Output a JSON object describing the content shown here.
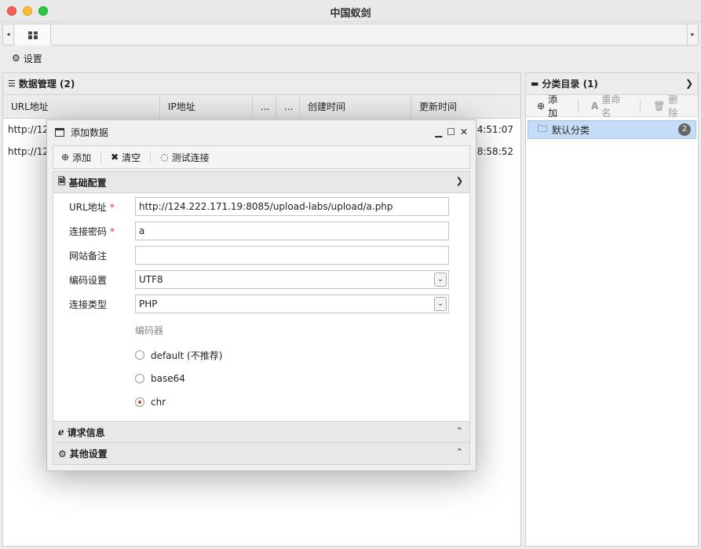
{
  "window": {
    "title": "中国蚁剑"
  },
  "tabs": {
    "left_arrow": "◂",
    "right_arrow": "▸"
  },
  "settings": {
    "label": "设置"
  },
  "data_panel": {
    "title": "数据管理 (2)",
    "columns": [
      "URL地址",
      "IP地址",
      "...",
      "...",
      "创建时间",
      "更新时间"
    ],
    "rows": [
      {
        "url": "http://12",
        "updated": "4:51:07"
      },
      {
        "url": "http://12",
        "updated": "8:58:52"
      }
    ]
  },
  "category_panel": {
    "title": "分类目录 (1)",
    "add_label": "添加",
    "rename_label": "重命名",
    "delete_label": "删除",
    "item_label": "默认分类",
    "item_count": "2"
  },
  "dialog": {
    "title": "添加数据",
    "toolbar": {
      "add": "添加",
      "clear": "清空",
      "test": "测试连接"
    },
    "basic_section": "基础配置",
    "fields": {
      "url_label": "URL地址",
      "url_value": "http://124.222.171.19:8085/upload-labs/upload/a.php",
      "password_label": "连接密码",
      "password_value": "a",
      "note_label": "网站备注",
      "note_value": "",
      "encoding_label": "编码设置",
      "encoding_value": "UTF8",
      "type_label": "连接类型",
      "type_value": "PHP",
      "required_mark": "*"
    },
    "encoder": {
      "label": "编码器",
      "options": [
        "default (不推荐)",
        "base64",
        "chr"
      ],
      "selected": "chr"
    },
    "request_section": "请求信息",
    "other_section": "其他设置"
  }
}
